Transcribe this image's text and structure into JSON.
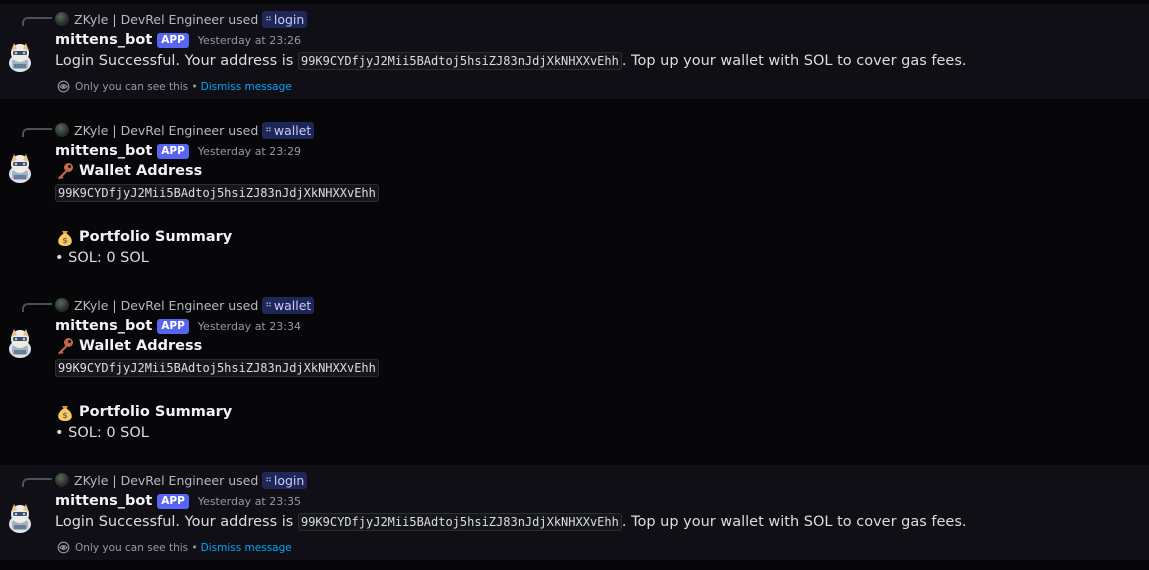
{
  "messages": [
    {
      "reply": {
        "user": "ZKyle | DevRel Engineer",
        "used": "used",
        "command": "login"
      },
      "author": "mittens_bot",
      "tag": "APP",
      "timestamp": "Yesterday at 23:26",
      "text_before": "Login Successful. Your address is ",
      "address": "99K9CYDfjyJ2Mii5BAdtoj5hsiZJ83nJdjXkNHXXvEhh",
      "text_after": ". Top up your wallet with SOL to cover gas fees.",
      "ephemeral_note": "Only you can see this •",
      "dismiss": "Dismiss message"
    },
    {
      "reply": {
        "user": "ZKyle | DevRel Engineer",
        "used": "used",
        "command": "wallet"
      },
      "author": "mittens_bot",
      "tag": "APP",
      "timestamp": "Yesterday at 23:29",
      "wallet_heading": "Wallet Address",
      "address": "99K9CYDfjyJ2Mii5BAdtoj5hsiZJ83nJdjXkNHXXvEhh",
      "portfolio_heading": "Portfolio Summary",
      "balance": "• SOL: 0 SOL"
    },
    {
      "reply": {
        "user": "ZKyle | DevRel Engineer",
        "used": "used",
        "command": "wallet"
      },
      "author": "mittens_bot",
      "tag": "APP",
      "timestamp": "Yesterday at 23:34",
      "wallet_heading": "Wallet Address",
      "address": "99K9CYDfjyJ2Mii5BAdtoj5hsiZJ83nJdjXkNHXXvEhh",
      "portfolio_heading": "Portfolio Summary",
      "balance": "• SOL: 0 SOL"
    },
    {
      "reply": {
        "user": "ZKyle | DevRel Engineer",
        "used": "used",
        "command": "login"
      },
      "author": "mittens_bot",
      "tag": "APP",
      "timestamp": "Yesterday at 23:35",
      "text_before": "Login Successful. Your address is ",
      "address": "99K9CYDfjyJ2Mii5BAdtoj5hsiZJ83nJdjXkNHXXvEhh",
      "text_after": ". Top up your wallet with SOL to cover gas fees.",
      "ephemeral_note": "Only you can see this •",
      "dismiss": "Dismiss message"
    }
  ],
  "icons": {
    "key": "key-emoji",
    "money_bag": "money-bag-emoji",
    "eye": "eye-icon",
    "command": "slash-command-icon",
    "avatar": "bot-avatar"
  }
}
